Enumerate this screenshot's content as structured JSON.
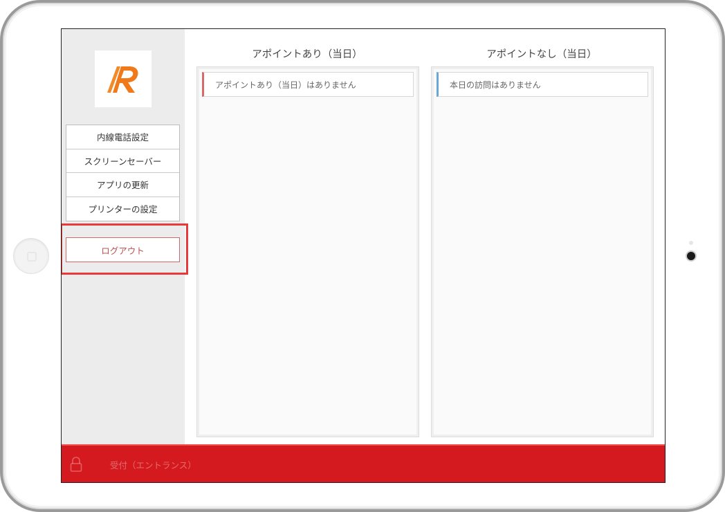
{
  "sidebar": {
    "menu_items": [
      {
        "label": "内線電話設定"
      },
      {
        "label": "スクリーンセーバー"
      },
      {
        "label": "アプリの更新"
      },
      {
        "label": "プリンターの設定"
      }
    ],
    "logout_label": "ログアウト"
  },
  "columns": {
    "with_appointment": {
      "title": "アポイントあり（当日）",
      "empty_message": "アポイントあり（当日）はありません"
    },
    "without_appointment": {
      "title": "アポイントなし（当日）",
      "empty_message": "本日の訪問はありません"
    }
  },
  "footer": {
    "label": "受付（エントランス）"
  },
  "colors": {
    "footer_bg": "#d41a1f",
    "highlight": "#e83a3a",
    "logo_orange": "#f07a1a",
    "accent_red": "#d66a6a",
    "accent_blue": "#6aa6d6"
  },
  "icons": {
    "logo": "r-logo-icon",
    "footer": "lock-icon"
  }
}
